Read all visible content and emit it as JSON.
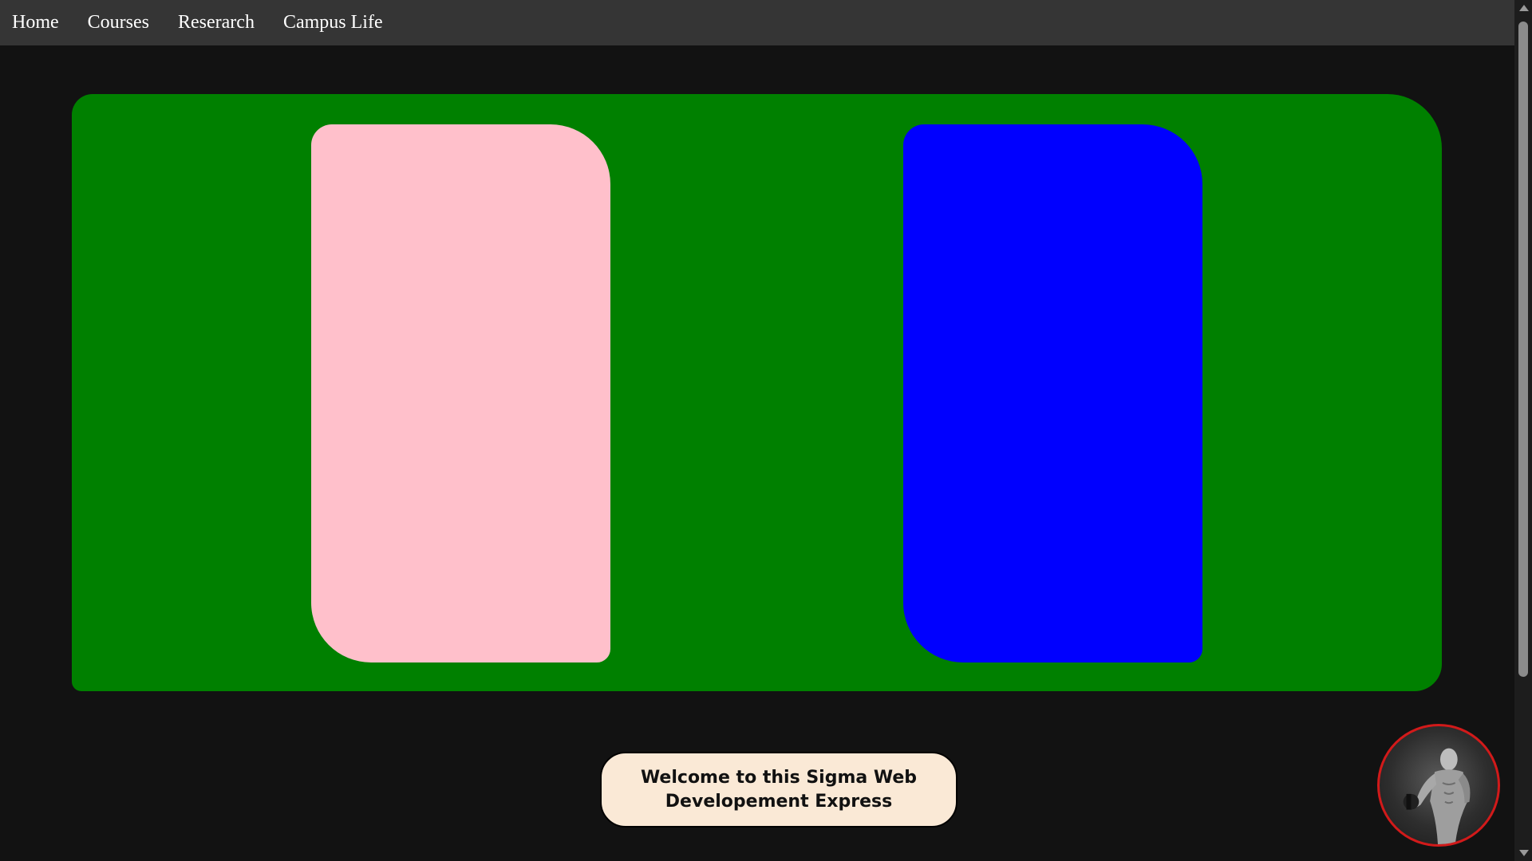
{
  "nav": {
    "items": [
      {
        "label": "Home"
      },
      {
        "label": "Courses"
      },
      {
        "label": "Reserarch"
      },
      {
        "label": "Campus Life"
      }
    ]
  },
  "hero": {
    "background": "#008000",
    "panels": [
      {
        "color": "#ffc0cb"
      },
      {
        "color": "#0000ff"
      }
    ]
  },
  "welcome": {
    "text": "Welcome to this Sigma Web Developement Express"
  },
  "avatar": {
    "icon": "bodybuilder-photo-icon",
    "border_color": "#d11a1a"
  },
  "colors": {
    "page_background": "#121212",
    "navbar_background": "#353535",
    "welcome_background": "#fae9d6"
  }
}
